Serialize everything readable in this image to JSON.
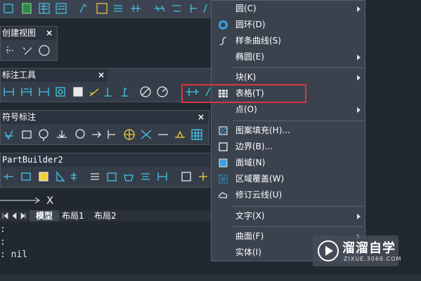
{
  "colors": {
    "accent": "#3aa0e0",
    "highlight": "#d9363e",
    "panel_bg": "#353d49",
    "menu_bg": "#3a424e",
    "icon_cyan": "#43c6e8",
    "icon_yellow": "#f0d23a"
  },
  "panels": [
    {
      "title": "创建视图",
      "close": "×"
    },
    {
      "title": "标注工具",
      "close": "×"
    },
    {
      "title": "符号标注",
      "close": "×"
    },
    {
      "title": "PartBuilder2",
      "close": ""
    }
  ],
  "sketch": {
    "axis_label": "X"
  },
  "tabs": {
    "model": "模型",
    "layout1": "布局1",
    "layout2": "布局2"
  },
  "command_lines": [
    ":",
    ":",
    ": nil"
  ],
  "menu": {
    "items": [
      {
        "label": "圆(C)",
        "icon": "",
        "has_submenu": true
      },
      {
        "label": "圆环(D)",
        "icon": "donut-icon",
        "has_submenu": false
      },
      {
        "label": "样条曲线(S)",
        "icon": "spline-icon",
        "has_submenu": false
      },
      {
        "label": "椭圆(E)",
        "icon": "",
        "has_submenu": true
      },
      {
        "label": "块(K)",
        "icon": "",
        "has_submenu": true
      },
      {
        "label": "表格(T)",
        "icon": "table-icon",
        "has_submenu": false
      },
      {
        "label": "点(O)",
        "icon": "",
        "has_submenu": true
      },
      {
        "label": "图案填充(H)...",
        "icon": "hatch-icon",
        "has_submenu": false
      },
      {
        "label": "边界(B)...",
        "icon": "boundary-icon",
        "has_submenu": false
      },
      {
        "label": "面域(N)",
        "icon": "region-icon",
        "has_submenu": false
      },
      {
        "label": "区域覆盖(W)",
        "icon": "wipeout-icon",
        "has_submenu": false
      },
      {
        "label": "修订云线(U)",
        "icon": "revcloud-icon",
        "has_submenu": false
      },
      {
        "label": "文字(X)",
        "icon": "",
        "has_submenu": true
      },
      {
        "label": "曲面(F)",
        "icon": "",
        "has_submenu": true
      },
      {
        "label": "实体(I)",
        "icon": "",
        "has_submenu": true
      }
    ]
  },
  "watermark": {
    "brand": "溜溜自学",
    "url": "ZIXUE.3066.COM"
  }
}
